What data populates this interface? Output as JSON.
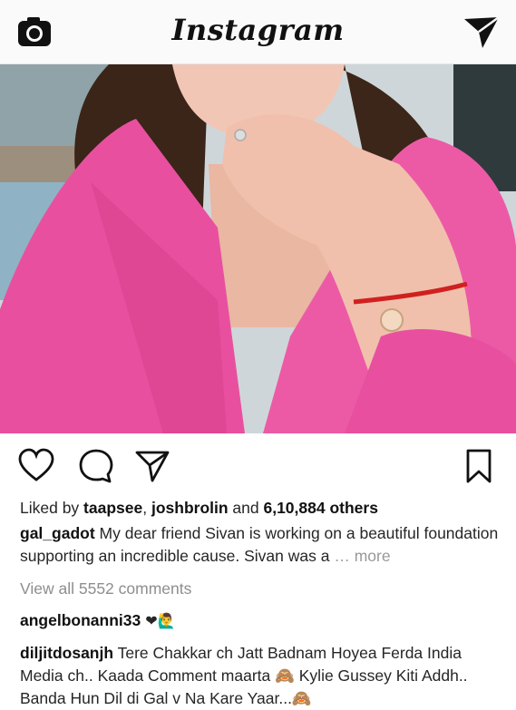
{
  "header": {
    "brand": "Instagram",
    "camera_icon": "camera-icon",
    "direct_icon": "paper-plane-icon"
  },
  "post": {
    "actions": {
      "like_icon": "heart-icon",
      "comment_icon": "comment-bubble-icon",
      "share_icon": "paper-plane-icon",
      "save_icon": "bookmark-icon"
    },
    "likes": {
      "prefix": "Liked by ",
      "user1": "taapsee",
      "sep": ", ",
      "user2": "joshbrolin",
      "and": " and ",
      "count": "6,10,884 others"
    },
    "caption": {
      "username": "gal_gadot",
      "text": " My dear friend Sivan is working on a beautiful foundation supporting an incredible cause. Sivan was a ",
      "more": "… more"
    },
    "view_all": "View all 5552 comments",
    "comments": [
      {
        "username": "angelbonanni33",
        "text": " ❤🙋‍♂"
      },
      {
        "username": "diljitdosanjh",
        "text": " Tere Chakkar ch Jatt Badnam Hoyea Ferda India Media ch.. Kaada Comment maarta 🙈 Kylie Gussey Kiti Addh.. Banda Hun Dil di Gal v Na Kare Yaar...🙈"
      }
    ]
  },
  "colors": {
    "jacket_pink": "#e8509f",
    "background": "#ffffff",
    "muted_text": "#8e8e8e"
  }
}
